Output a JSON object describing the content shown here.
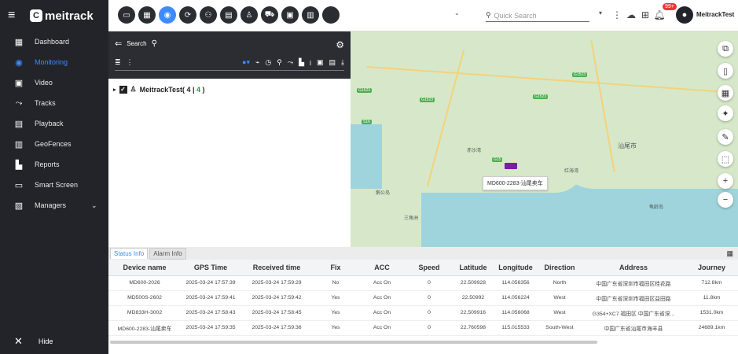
{
  "brand": {
    "name": "meitrack"
  },
  "sidebar": {
    "items": [
      {
        "label": "Dashboard",
        "icon": "dashboard-icon",
        "glyph": "▦"
      },
      {
        "label": "Monitoring",
        "icon": "location-person-icon",
        "glyph": "◉"
      },
      {
        "label": "Video",
        "icon": "video-icon",
        "glyph": "▣"
      },
      {
        "label": "Tracks",
        "icon": "tracks-icon",
        "glyph": "⤳"
      },
      {
        "label": "Playback",
        "icon": "playback-icon",
        "glyph": "▤"
      },
      {
        "label": "GeoFences",
        "icon": "geofence-icon",
        "glyph": "▥"
      },
      {
        "label": "Reports",
        "icon": "reports-icon",
        "glyph": "▙"
      },
      {
        "label": "Smart Screen",
        "icon": "smart-screen-icon",
        "glyph": "▭"
      },
      {
        "label": "Managers",
        "icon": "managers-icon",
        "glyph": "▧"
      }
    ],
    "hide_label": "Hide"
  },
  "topbar": {
    "search_placeholder": "Quick Search",
    "badge": "99+",
    "user": "MeitrackTest",
    "icons": [
      "monitor-icon",
      "dashboard-grid-icon",
      "location-icon",
      "refresh-icon",
      "group-icon",
      "calendar-icon",
      "user-icon",
      "car-icon",
      "id-card-icon",
      "building-icon",
      "more-icon"
    ]
  },
  "tree": {
    "search_label": "Search",
    "node_name": "MeitrackTest",
    "count_total": "4",
    "count_online": "4"
  },
  "map": {
    "tooltip": "MD600-2283-汕尾卖车"
  },
  "tabs": [
    "Status Info",
    "Alarm Info"
  ],
  "table": {
    "headers": [
      "Device name",
      "GPS Time",
      "Received time",
      "Fix",
      "ACC",
      "Speed",
      "Latitude",
      "Longitude",
      "Direction",
      "Address",
      "Journey"
    ],
    "rows": [
      [
        "MD600-2026",
        "2025-03-24 17:57:39",
        "2025-03-24 17:59:29",
        "No",
        "Acc On",
        "0",
        "22.509928",
        "114.056356",
        "North",
        "中国广东省深圳市福田区桂花路",
        "712.8km"
      ],
      [
        "MD500S-2602",
        "2025-03-24 17:59:41",
        "2025-03-24 17:59:42",
        "Yes",
        "Acc On",
        "0",
        "22.50992",
        "114.056224",
        "West",
        "中国广东省深圳市福田区益田路",
        "11.8km"
      ],
      [
        "MD833H-3002",
        "2025-03-24 17:58:43",
        "2025-03-24 17:58:45",
        "Yes",
        "Acc On",
        "0",
        "22.509916",
        "114.056068",
        "West",
        "G354+XC7 福田区 中国广东省深...",
        "1531.0km"
      ],
      [
        "MD600-2283-汕尾卖车",
        "2025-03-24 17:59:35",
        "2025-03-24 17:59:36",
        "Yes",
        "Acc On",
        "0",
        "22.760598",
        "115.015533",
        "South-West",
        "中国广东省汕尾市海丰县",
        "24689.1km"
      ]
    ]
  }
}
